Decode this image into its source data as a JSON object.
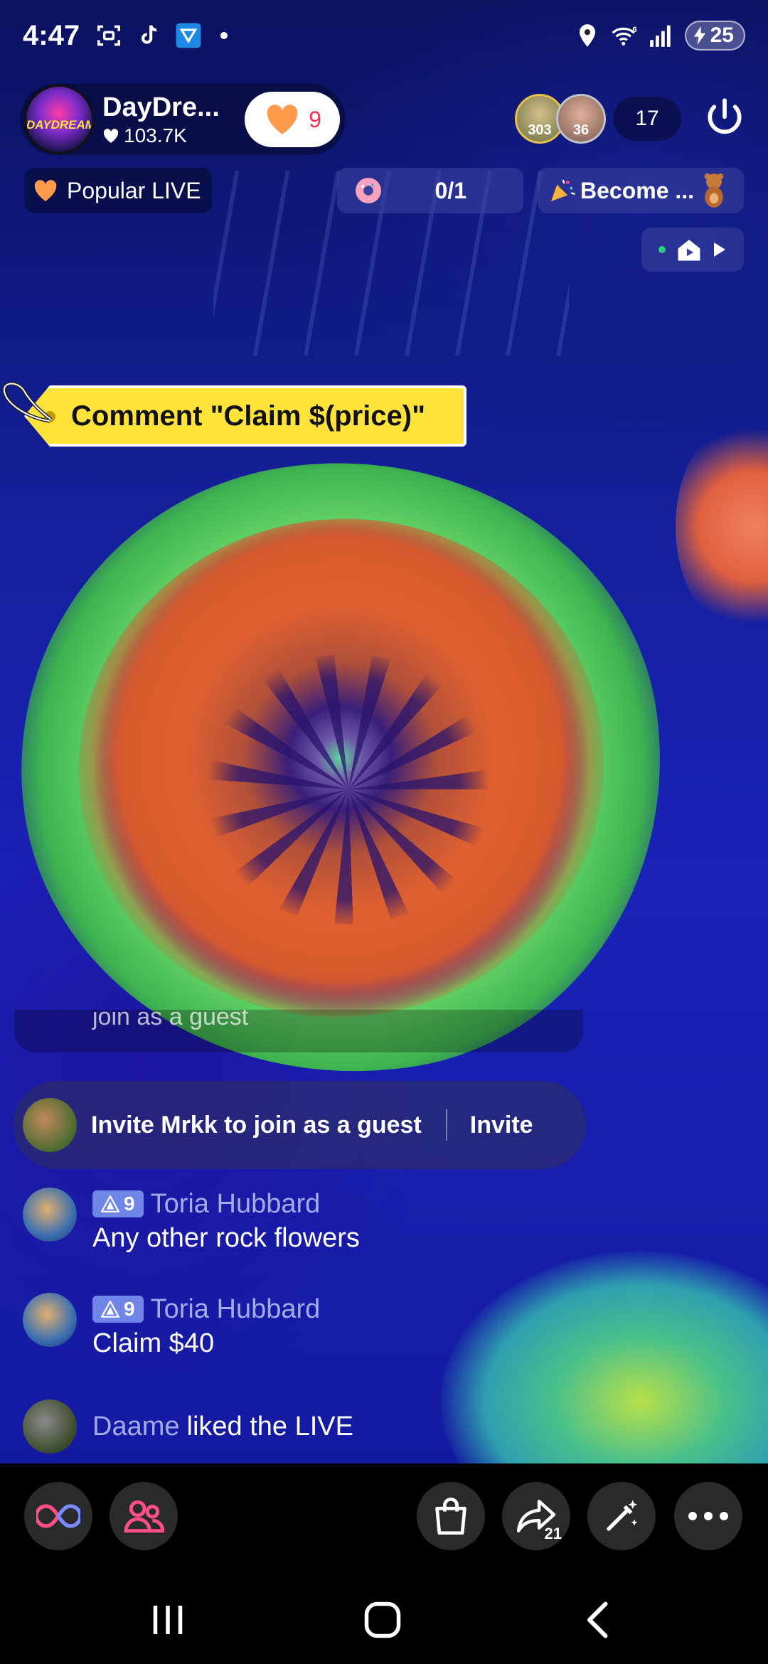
{
  "status_bar": {
    "time": "4:47",
    "wifi_badge": "6",
    "battery": "25",
    "icons": [
      "screenshot-icon",
      "tiktok-icon",
      "download-icon",
      "location-icon",
      "wifi-icon",
      "signal-icon",
      "battery-icon"
    ]
  },
  "host": {
    "name": "DayDre...",
    "likes": "103.7K",
    "avatar_text": "DAYDREAM",
    "follow_count": "9"
  },
  "viewers": {
    "avatar1_badge": "303",
    "avatar2_badge": "36",
    "count": "17"
  },
  "badges": {
    "popular_live": "Popular LIVE",
    "goal": "0/1",
    "become": "Become ..."
  },
  "comment_tag": {
    "text": "Comment \"Claim $(price)\""
  },
  "chat": {
    "faded_text": "join as a guest",
    "invite": {
      "text": "Invite Mrkk to join as a guest",
      "button": "Invite"
    },
    "messages": [
      {
        "level": "9",
        "user": "Toria Hubbard",
        "text": "Any other rock flowers"
      },
      {
        "level": "9",
        "user": "Toria Hubbard",
        "text": "Claim $40"
      }
    ],
    "like_event": {
      "user": "Daame",
      "text": "liked the LIVE"
    }
  },
  "actions": {
    "share_count": "21"
  },
  "colors": {
    "accent": "#fe2c55",
    "tag_yellow": "#ffe33a",
    "level_badge": "#6f86e8"
  }
}
